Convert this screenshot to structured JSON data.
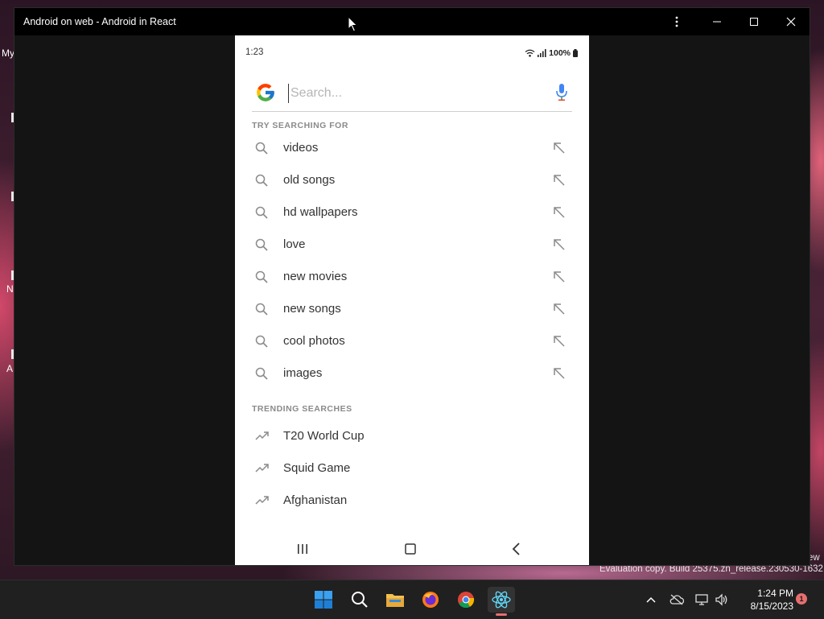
{
  "window": {
    "title": "Android on web - Android in React"
  },
  "desktop": {
    "fragments": [
      "My",
      "N",
      "A"
    ],
    "watermark": "Evaluation copy. Build 25375.zn_release.230530-1632",
    "watermark_extra": "ew"
  },
  "phone": {
    "status": {
      "time": "1:23",
      "battery": "100%"
    },
    "search": {
      "placeholder": "Search..."
    },
    "try_section": {
      "label": "TRY SEARCHING FOR",
      "items": [
        "videos",
        "old songs",
        "hd wallpapers",
        "love",
        "new movies",
        "new songs",
        "cool photos",
        "images"
      ]
    },
    "trending_section": {
      "label": "TRENDING SEARCHES",
      "items": [
        "T20 World Cup",
        "Squid Game",
        "Afghanistan"
      ]
    }
  },
  "taskbar": {
    "time": "1:24 PM",
    "date": "8/15/2023",
    "notification_count": "1"
  },
  "colors": {
    "titlebar": "#000000",
    "window_bg": "#141414",
    "phone_bg": "#ffffff",
    "accent_red": "#e76f6f"
  }
}
